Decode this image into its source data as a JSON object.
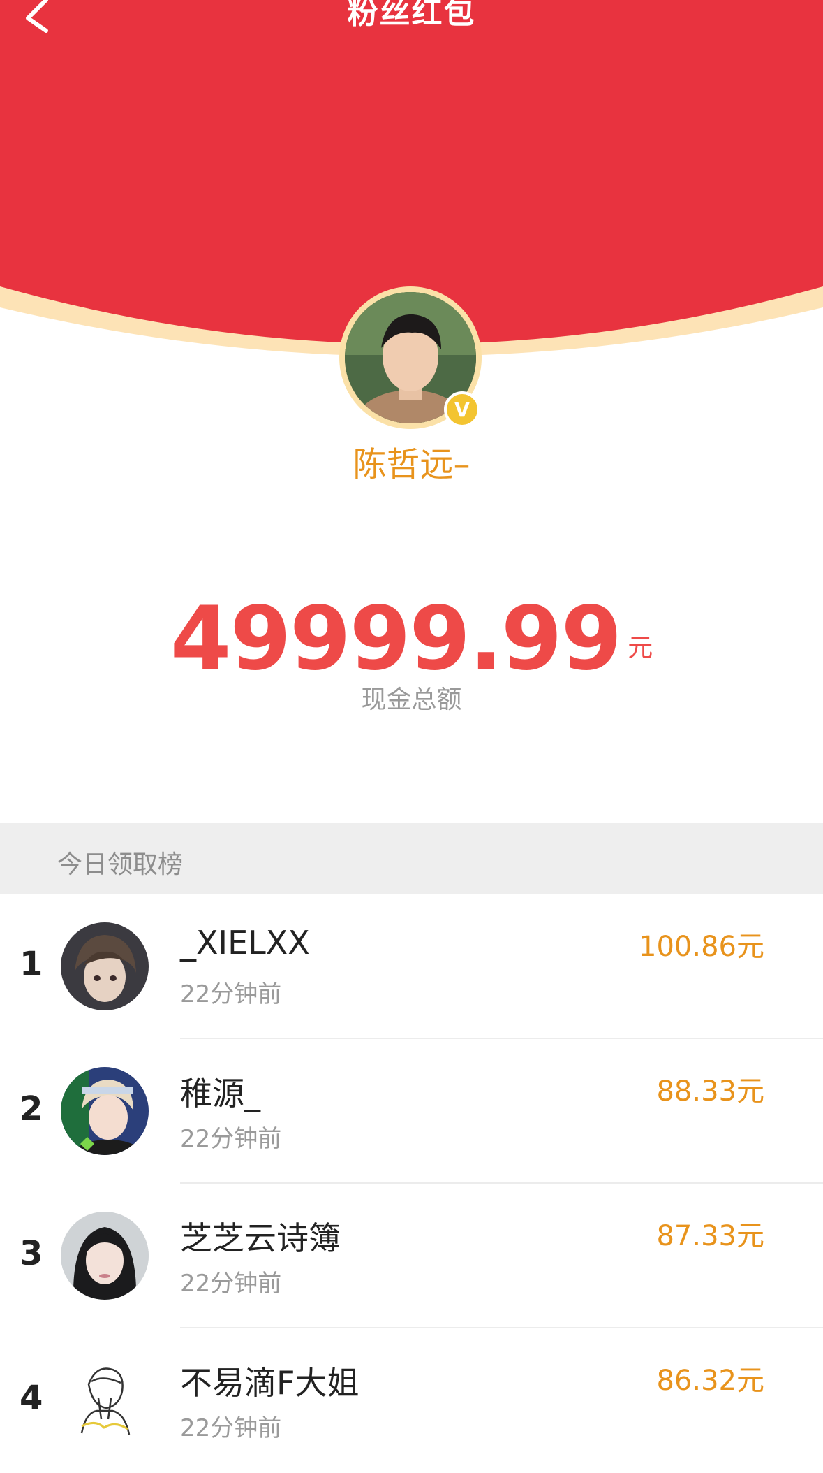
{
  "nav": {
    "title": "粉丝红包"
  },
  "host": {
    "name": "陈哲远–"
  },
  "amount": {
    "value": "49999.99",
    "unit": "元",
    "label": "现金总额"
  },
  "ranking": {
    "title": "今日领取榜",
    "rows": [
      {
        "rank": "1",
        "name": "_XIELXX",
        "time": "22分钟前",
        "amount": "100.86元"
      },
      {
        "rank": "2",
        "name": "稚源_",
        "time": "22分钟前",
        "amount": "88.33元"
      },
      {
        "rank": "3",
        "name": "芝芝云诗簿",
        "time": "22分钟前",
        "amount": "87.33元"
      },
      {
        "rank": "4",
        "name": "不易滴F大姐",
        "time": "22分钟前",
        "amount": "86.32元"
      }
    ]
  },
  "colors": {
    "header_red": "#e8333f",
    "rim_cream": "#fde3b6",
    "amount_red": "#ee4a48",
    "accent_orange": "#e8931c"
  },
  "icons": {
    "back": "chevron-left-icon",
    "verified": "verified-v-badge-icon"
  }
}
